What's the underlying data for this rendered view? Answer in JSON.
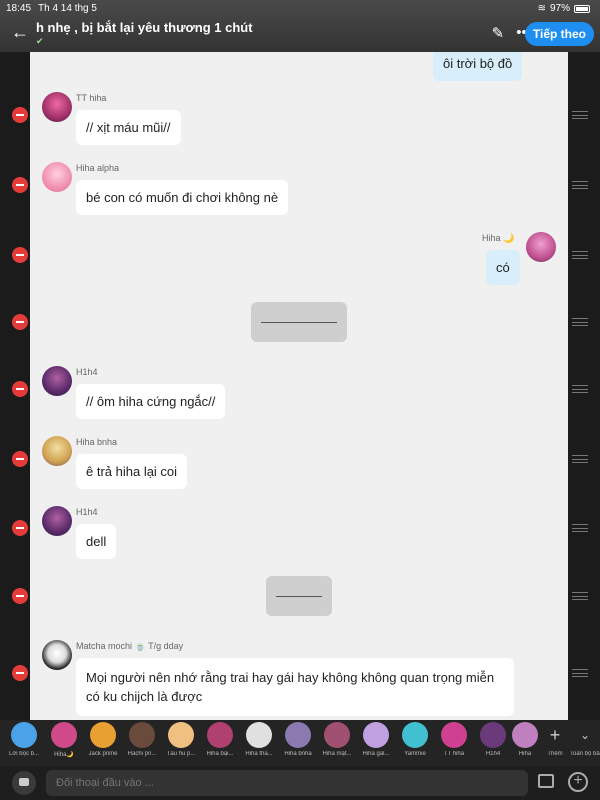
{
  "status": {
    "time": "18:45",
    "date": "Th 4 14 thg 5",
    "battery": "97%"
  },
  "header": {
    "title": "h nhẹ , bị bắt lại yêu thương 1 chút",
    "subtitle": "",
    "follow_label": "Tiếp theo",
    "more_label": "•••"
  },
  "messages": [
    {
      "sender": "",
      "text": "ôi trời bộ đồ",
      "mine": true
    },
    {
      "sender": "TT hiha",
      "text": "// xịt máu mũi//",
      "mine": false
    },
    {
      "sender": "Hiha alpha",
      "text": "bé con có muốn đi chơi không nè",
      "mine": false
    },
    {
      "sender": "Hiha 🌙",
      "text": "có",
      "mine": true
    },
    {
      "sender": "H1h4",
      "text": "// ôm hiha cứng ngắc//",
      "mine": false
    },
    {
      "sender": "Hiha bnha",
      "text": "ê trả hiha lại coi",
      "mine": false
    },
    {
      "sender": "H1h4",
      "text": "dell",
      "mine": false
    },
    {
      "sender": "Matcha mochi 🍵 T/g dday",
      "text": "Mọi người nên nhớ rằng trai hay gái hay không không quan trọng miễn có ku chijch là được",
      "mine": false
    }
  ],
  "strip": {
    "items": [
      {
        "label": "Lời bọc b...",
        "color": "#4aa3e8"
      },
      {
        "label": "Hiha🌙",
        "color": "#d04a8a"
      },
      {
        "label": "Jack prime",
        "color": "#e8a030"
      },
      {
        "label": "Hachi pri...",
        "color": "#6a4a3a"
      },
      {
        "label": "Tàu hũ p...",
        "color": "#f0c080"
      },
      {
        "label": "Hiha bại...",
        "color": "#b04070"
      },
      {
        "label": "Hiha tha...",
        "color": "#e0e0e0"
      },
      {
        "label": "Hiha bnha",
        "color": "#8a7ab0"
      },
      {
        "label": "Hiha mật...",
        "color": "#a05070"
      },
      {
        "label": "Hiha gal...",
        "color": "#c0a0e0"
      },
      {
        "label": "Yammie",
        "color": "#40c0d0"
      },
      {
        "label": "TT hiha",
        "color": "#d04090"
      },
      {
        "label": "H1h4",
        "color": "#6a3a7a"
      },
      {
        "label": "Hiha",
        "color": "#c080c0"
      }
    ],
    "more_label": "Thêm",
    "all_label": "Toàn bộ bảng"
  },
  "input": {
    "placeholder": "Đối thoại đầu vào ..."
  },
  "colors": {
    "accent": "#1f8ef1",
    "remove": "#e63b3b",
    "mine_bubble": "#d8eefb"
  },
  "icons": [
    "back-arrow-icon",
    "edit-icon",
    "more-icon",
    "minus-icon",
    "drag-handle-icon",
    "image-icon",
    "plus-icon"
  ]
}
